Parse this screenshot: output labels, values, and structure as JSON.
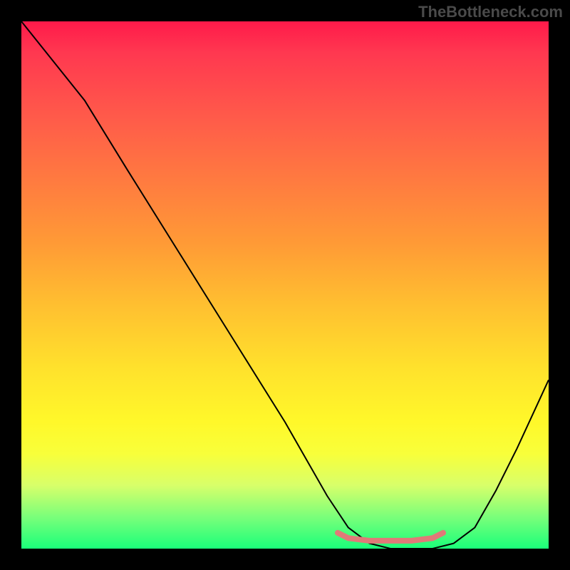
{
  "watermark": "TheBottleneck.com",
  "chart_data": {
    "type": "line",
    "title": "",
    "xlabel": "",
    "ylabel": "",
    "xlim": [
      0,
      100
    ],
    "ylim": [
      0,
      100
    ],
    "grid": false,
    "background_gradient": {
      "direction": "vertical",
      "stops": [
        {
          "pos": 0.0,
          "color": "#ff1a4a"
        },
        {
          "pos": 0.18,
          "color": "#ff5a4a"
        },
        {
          "pos": 0.42,
          "color": "#ff9a36"
        },
        {
          "pos": 0.66,
          "color": "#ffe22c"
        },
        {
          "pos": 0.82,
          "color": "#f8ff3a"
        },
        {
          "pos": 0.94,
          "color": "#7aff7a"
        },
        {
          "pos": 1.0,
          "color": "#1aff7a"
        }
      ]
    },
    "series": [
      {
        "name": "main-curve",
        "color": "#000000",
        "stroke_width": 2,
        "x": [
          0,
          4,
          8,
          12,
          20,
          30,
          40,
          50,
          58,
          62,
          66,
          70,
          74,
          78,
          82,
          86,
          90,
          94,
          100
        ],
        "values": [
          100,
          95,
          90,
          85,
          72,
          56,
          40,
          24,
          10,
          4,
          1,
          0,
          0,
          0,
          1,
          4,
          11,
          19,
          32
        ]
      },
      {
        "name": "highlight-band",
        "color": "#e07a78",
        "stroke_width": 8,
        "x": [
          60,
          62,
          66,
          70,
          74,
          78,
          80
        ],
        "values": [
          3,
          2,
          1.5,
          1.5,
          1.5,
          2,
          3
        ]
      }
    ]
  }
}
